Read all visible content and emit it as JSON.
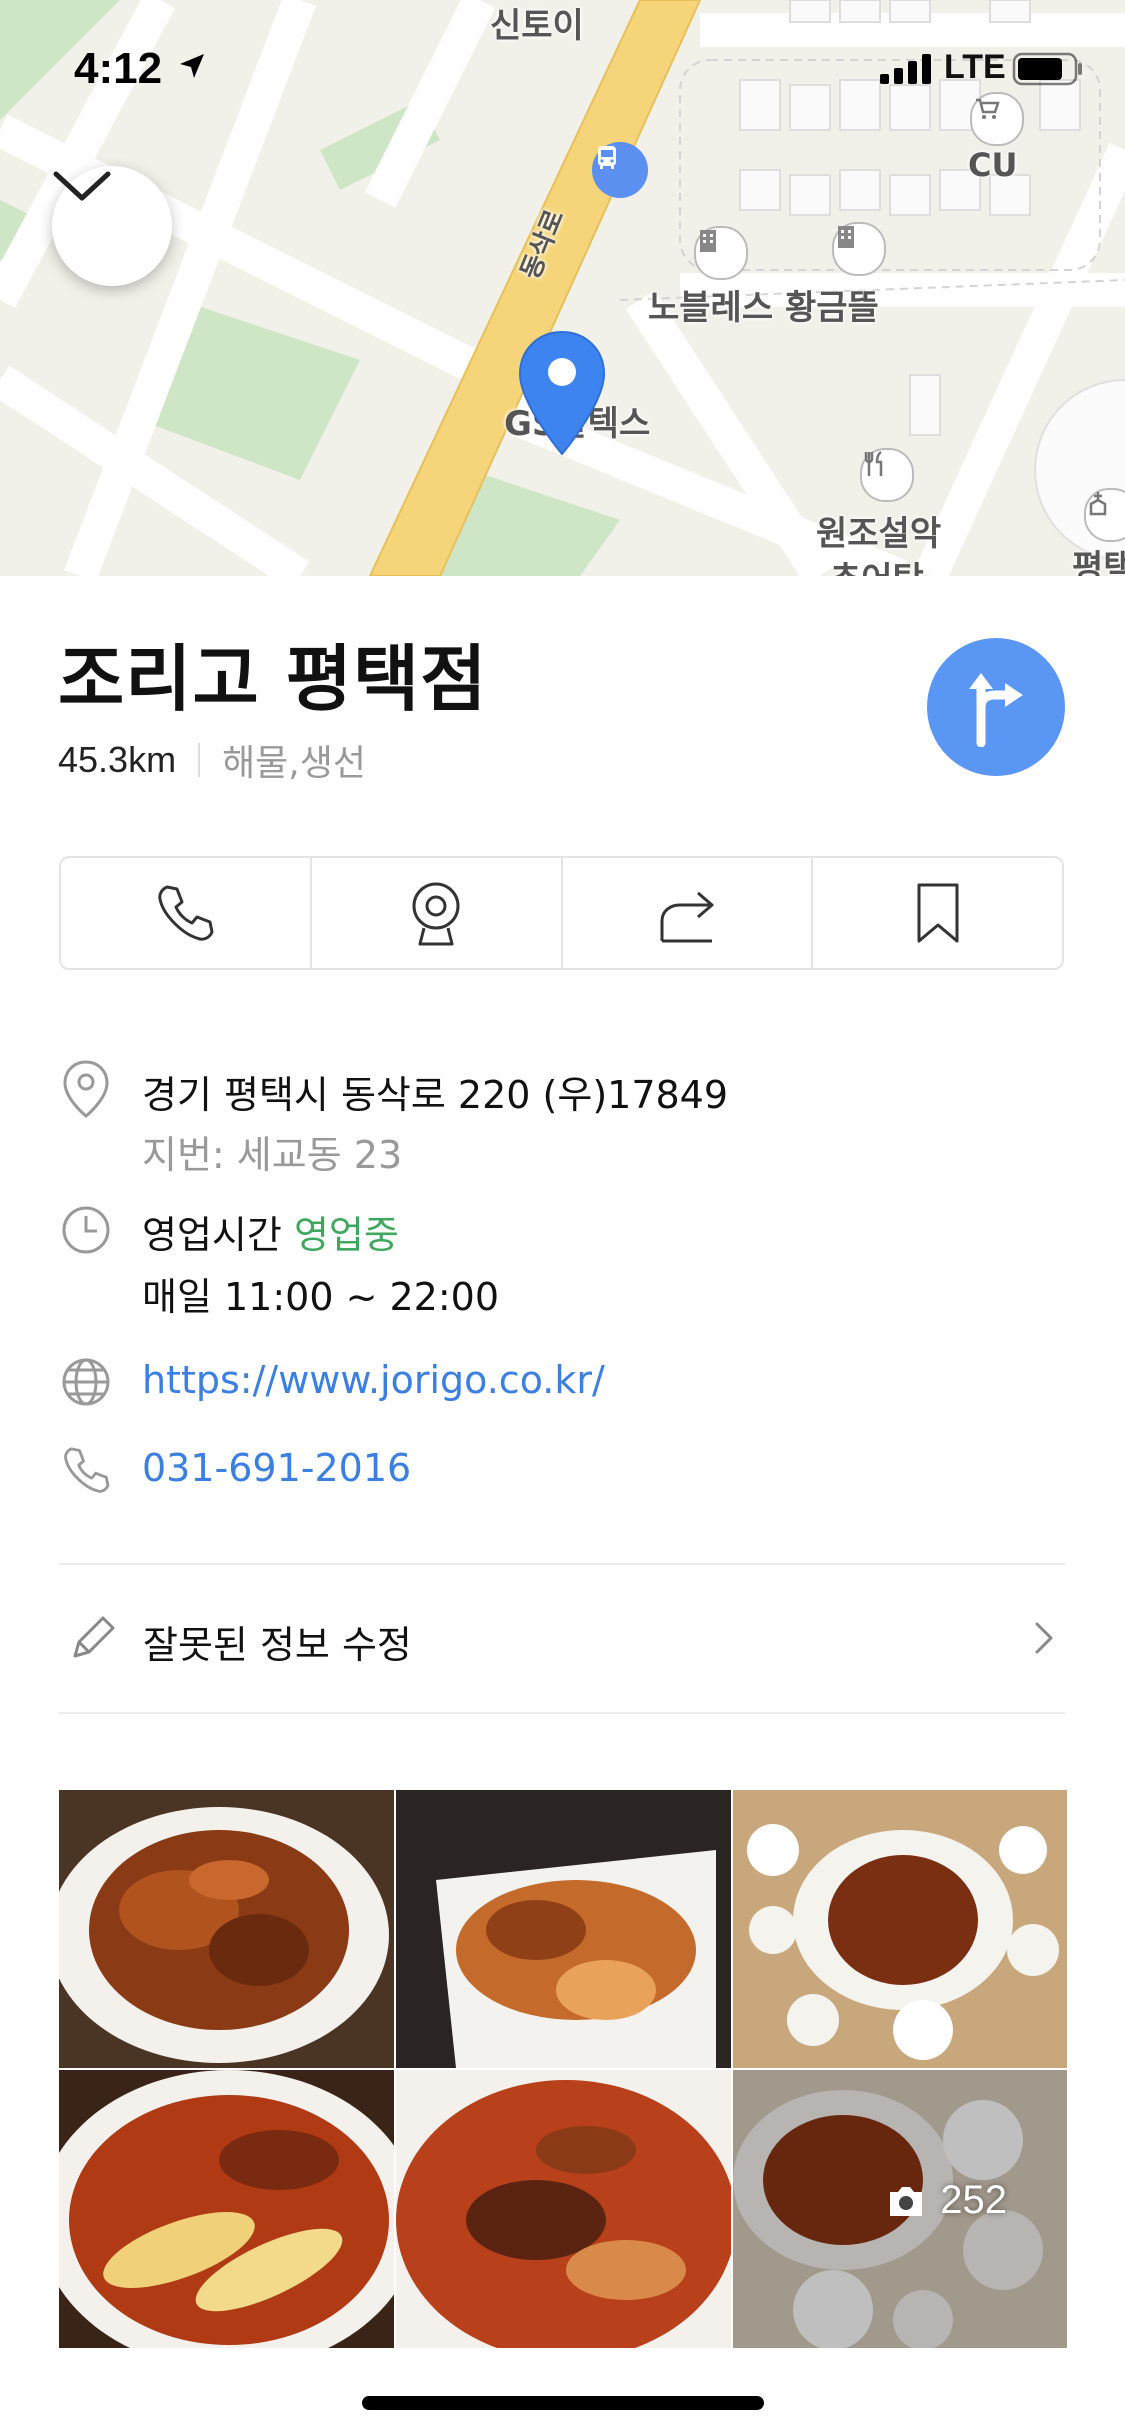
{
  "status_bar": {
    "time": "4:12",
    "network": "LTE"
  },
  "map": {
    "labels": {
      "top": "신토이",
      "cu": "CU",
      "apartment": "노블레스 황금뜰",
      "road": "동삭로",
      "place": "GS칼텍스",
      "restaurant_line1": "원조설악",
      "restaurant_line2": "추어탕",
      "right_edge": "평택"
    }
  },
  "place": {
    "name": "조리고 평택점",
    "distance": "45.3km",
    "category": "해물,생선"
  },
  "actions": {
    "call": "call-icon",
    "streetview": "streetview-icon",
    "share": "share-icon",
    "save": "bookmark-icon"
  },
  "details": {
    "address": "경기 평택시 동삭로 220 (우)17849",
    "lot_address": "지번: 세교동 23",
    "hours_label": "영업시간",
    "hours_status": "영업중",
    "hours": "매일 11:00 ~ 22:00",
    "website": "https://www.jorigo.co.kr/",
    "phone": "031-691-2016"
  },
  "edit": {
    "label": "잘못된 정보 수정"
  },
  "photos": {
    "count": "252"
  },
  "colors": {
    "accent": "#5a96f4",
    "open_green": "#3fa85e",
    "link_blue": "#3b7fe0",
    "road_yellow": "#f6d57a"
  }
}
